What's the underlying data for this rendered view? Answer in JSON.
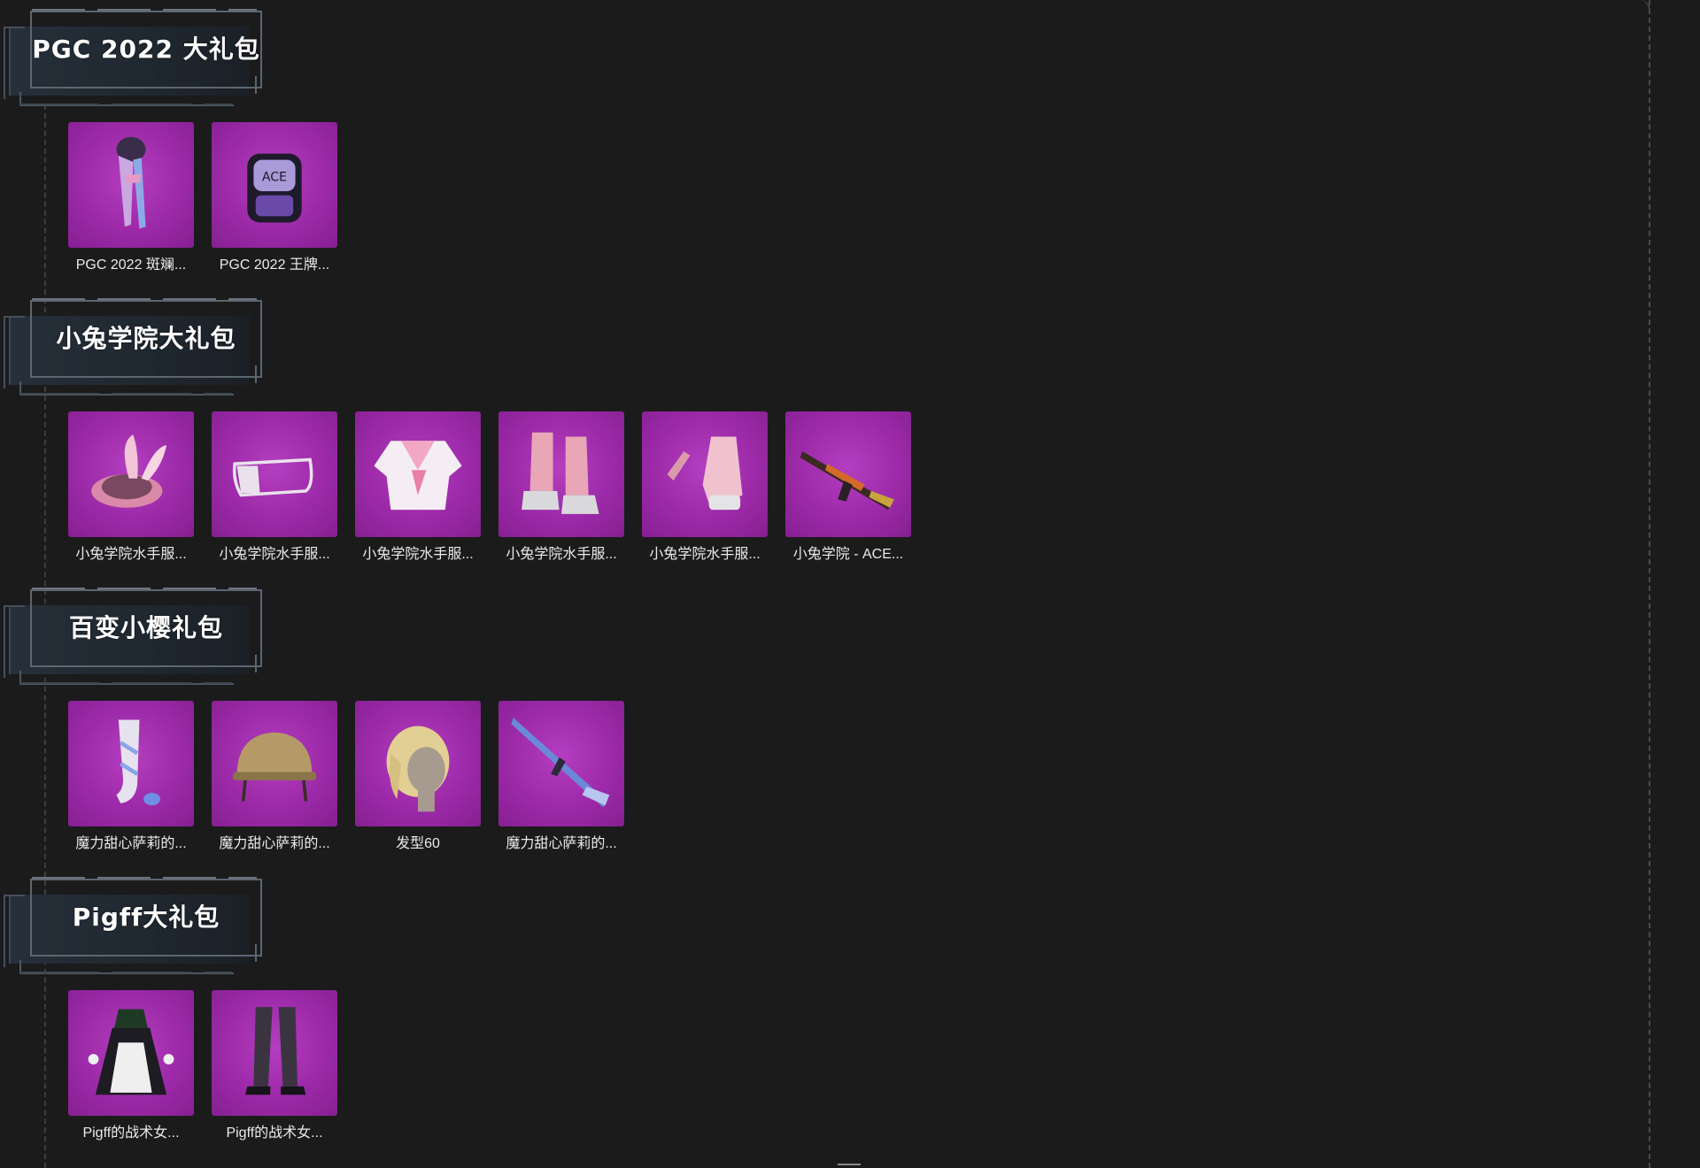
{
  "sections": [
    {
      "title": "PGC 2022 大礼包",
      "items": [
        {
          "label": "PGC 2022 斑斓...",
          "icon": "scarf-icon"
        },
        {
          "label": "PGC 2022 王牌...",
          "icon": "backpack-icon"
        }
      ]
    },
    {
      "title": "小兔学院大礼包",
      "items": [
        {
          "label": "小兔学院水手服...",
          "icon": "bunny-ear-hat-icon"
        },
        {
          "label": "小兔学院水手服...",
          "icon": "face-mask-icon"
        },
        {
          "label": "小兔学院水手服...",
          "icon": "sailor-top-icon"
        },
        {
          "label": "小兔学院水手服...",
          "icon": "boots-icon"
        },
        {
          "label": "小兔学院水手服...",
          "icon": "gloves-icon"
        },
        {
          "label": "小兔学院 - ACE...",
          "icon": "rifle-icon"
        }
      ]
    },
    {
      "title": "百变小樱礼包",
      "items": [
        {
          "label": "魔力甜心萨莉的...",
          "icon": "stockings-icon"
        },
        {
          "label": "魔力甜心萨莉的...",
          "icon": "helmet-icon"
        },
        {
          "label": "发型60",
          "icon": "hairstyle-icon"
        },
        {
          "label": "魔力甜心萨莉的...",
          "icon": "sniper-rifle-icon"
        }
      ]
    },
    {
      "title": "Pigff大礼包",
      "items": [
        {
          "label": "Pigff的战术女...",
          "icon": "maid-dress-icon"
        },
        {
          "label": "Pigff的战术女...",
          "icon": "leggings-icon"
        }
      ]
    }
  ]
}
